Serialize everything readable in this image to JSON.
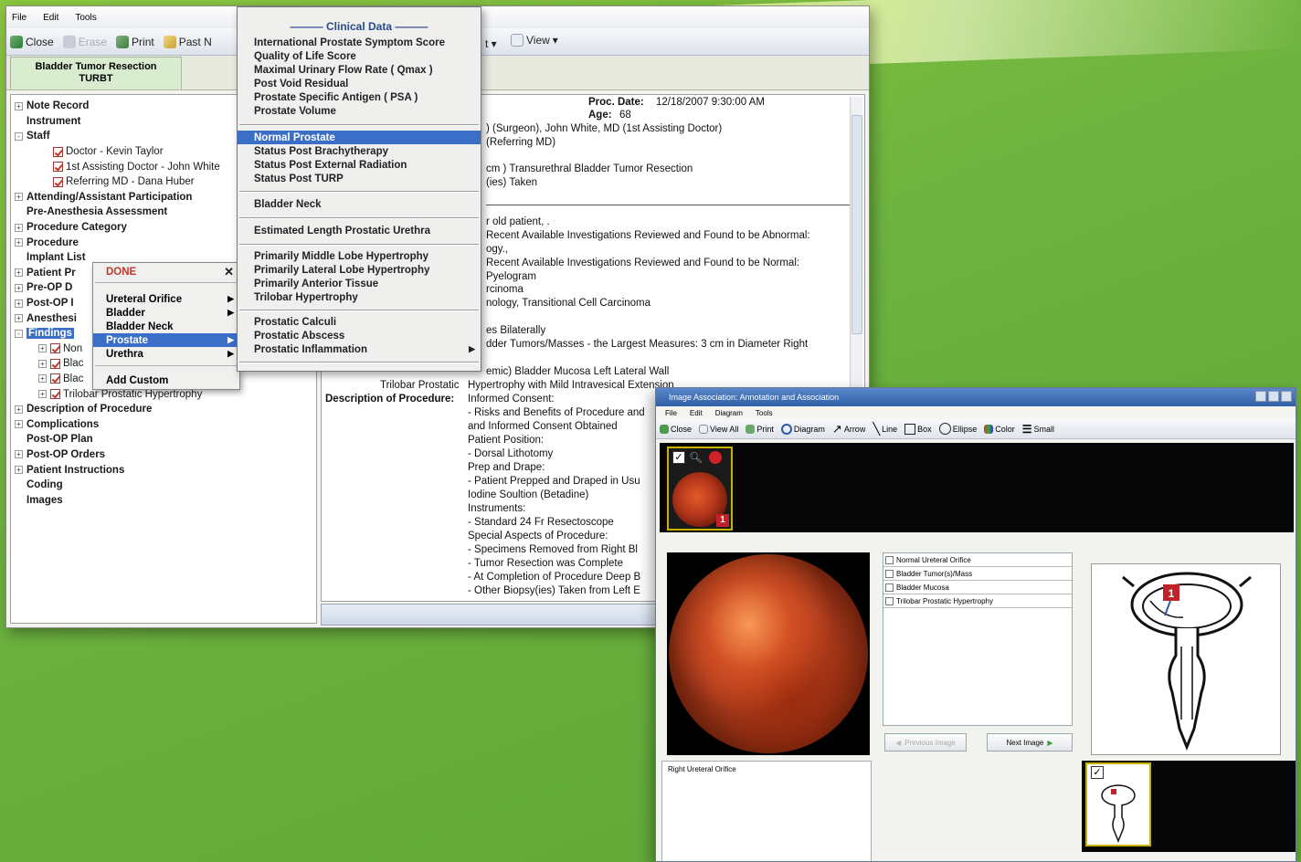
{
  "main": {
    "menu": [
      "File",
      "Edit",
      "Tools"
    ],
    "toolbar": {
      "close": "Close",
      "erase": "Erase",
      "print": "Print",
      "past": "Past N",
      "view": "View"
    },
    "tab_line1": "Bladder Tumor Resection",
    "tab_line2": "TURBT",
    "tree": [
      {
        "label": "Note Record",
        "exp": "+"
      },
      {
        "label": "Instrument",
        "exp": ""
      },
      {
        "label": "Staff",
        "exp": "-"
      },
      {
        "label": "Doctor - Kevin Taylor",
        "chk": true
      },
      {
        "label": "1st Assisting Doctor - John White",
        "chk": true
      },
      {
        "label": "Referring MD - Dana Huber",
        "chk": true
      },
      {
        "label": "Attending/Assistant Participation",
        "exp": "+"
      },
      {
        "label": "Pre-Anesthesia Assessment",
        "exp": ""
      },
      {
        "label": "Procedure Category",
        "exp": "+"
      },
      {
        "label": "Procedure",
        "exp": "+"
      },
      {
        "label": "Implant List",
        "exp": ""
      },
      {
        "label": "Patient Pr",
        "exp": "+"
      },
      {
        "label": "Pre-OP D",
        "exp": "+"
      },
      {
        "label": "Post-OP I",
        "exp": "+"
      },
      {
        "label": "Anesthesi",
        "exp": "+"
      },
      {
        "label": "Findings",
        "exp": "-",
        "sel": true
      },
      {
        "label": "Non",
        "sub": true,
        "chk": true
      },
      {
        "label": "Blac",
        "sub": true,
        "chk": true
      },
      {
        "label": "Blac",
        "sub": true,
        "chk": true
      },
      {
        "label": "Trilobar Prostatic Hypertrophy",
        "sub": true,
        "chk": true
      },
      {
        "label": "Description of Procedure",
        "exp": "+"
      },
      {
        "label": "Complications",
        "exp": "+"
      },
      {
        "label": "Post-OP Plan",
        "exp": ""
      },
      {
        "label": "Post-OP Orders",
        "exp": "+"
      },
      {
        "label": "Patient Instructions",
        "exp": "+"
      },
      {
        "label": "Coding",
        "exp": ""
      },
      {
        "label": "Images",
        "exp": ""
      }
    ],
    "doc": {
      "proc_date_label": "Proc. Date:",
      "proc_date": "12/18/2007 9:30:00 AM",
      "age_label": "Age:",
      "age": "68",
      "lines": [
        ") (Surgeon), John White, MD (1st Assisting Doctor)",
        "(Referring MD)",
        "cm ) Transurethral Bladder Tumor Resection",
        "(ies) Taken",
        "r old patient, .",
        "Recent Available Investigations Reviewed and Found to be Abnormal:",
        "ogy.,",
        "Recent Available Investigations Reviewed and Found to be Normal:",
        "Pyelogram",
        "rcinoma",
        "nology, Transitional Cell Carcinoma",
        "es Bilaterally",
        "dder Tumors/Masses - the Largest Measures: 3 cm in Diameter Right",
        "emic) Bladder Mucosa Left Lateral Wall"
      ],
      "trilobar_label": "Trilobar Prostatic",
      "trilobar_text": "Hypertrophy with Mild Intravesical Extension",
      "desc_label": "Description of Procedure:",
      "desc_lines": [
        "Informed Consent:",
        "  - Risks and Benefits of Procedure and",
        "and Informed Consent Obtained",
        "Patient Position:",
        "  - Dorsal Lithotomy",
        "Prep and Drape:",
        "  - Patient Prepped and Draped in Usu",
        "Iodine Soultion (Betadine)",
        "Instruments:",
        "  - Standard 24 Fr Resectoscope",
        "Special Aspects of Procedure:",
        "  - Specimens Removed from Right Bl",
        "  - Tumor Resection was Complete",
        "  - At Completion of Procedure Deep B",
        "  - Other Biopsy(ies) Taken from Left E"
      ]
    }
  },
  "context_menu": {
    "done": "DONE",
    "close": "✕",
    "items": [
      "Ureteral Orifice",
      "Bladder",
      "Bladder Neck",
      "Prostate",
      "Urethra"
    ],
    "add_custom": "Add Custom"
  },
  "submenu": {
    "header": "Clinical Data",
    "group1": [
      "International Prostate Symptom Score",
      "Quality of Life Score",
      "Maximal Urinary Flow Rate ( Qmax )",
      "Post Void Residual",
      "Prostate Specific Antigen ( PSA )",
      "Prostate Volume"
    ],
    "group2": [
      "Normal Prostate",
      "Status Post Brachytherapy",
      "Status Post External Radiation",
      "Status Post TURP"
    ],
    "bladder_neck": "Bladder Neck",
    "urethra_length": "Estimated Length Prostatic Urethra",
    "group3": [
      "Primarily Middle Lobe Hypertrophy",
      "Primarily Lateral Lobe Hypertrophy",
      "Primarily Anterior Tissue",
      "Trilobar Hypertrophy"
    ],
    "group4": [
      "Prostatic Calculi",
      "Prostatic Abscess",
      "Prostatic Inflammation"
    ]
  },
  "image_window": {
    "title": "Image Association: Annotation and Association",
    "menu": [
      "File",
      "Edit",
      "Diagram",
      "Tools"
    ],
    "toolbar": [
      "Close",
      "View All",
      "Print",
      "Diagram",
      "Arrow",
      "Line",
      "Box",
      "Ellipse",
      "Color",
      "Small"
    ],
    "thumb_badge": "1",
    "findings": [
      "Normal Ureteral Orifice",
      "Bladder Tumor(s)/Mass",
      "Bladder Mucosa",
      "Trilobar Prostatic Hypertrophy"
    ],
    "prev_btn": "Previous Image",
    "next_btn": "Next Image",
    "diagram_badge": "1",
    "notes": "Right Ureteral Orifice"
  },
  "colors": {
    "background": "#6db33f",
    "highlight": "#3b6ec7",
    "badge": "#c0222a"
  }
}
